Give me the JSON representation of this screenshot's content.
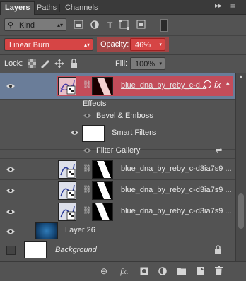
{
  "tabs": [
    {
      "label": "Layers"
    },
    {
      "label": "Paths"
    },
    {
      "label": "Channels"
    }
  ],
  "filter": {
    "kind_label": "Kind"
  },
  "blend": {
    "mode": "Linear Burn",
    "opacity_label": "Opacity:",
    "opacity_value": "46%"
  },
  "lock": {
    "label": "Lock:",
    "fill_label": "Fill:",
    "fill_value": "100%"
  },
  "layers": [
    {
      "name": "blue_dna_by_reby_c-d...",
      "selected": true
    },
    {
      "name": "blue_dna_by_reby_c-d3ia7s9 ..."
    },
    {
      "name": "blue_dna_by_reby_c-d3ia7s9 ..."
    },
    {
      "name": "blue_dna_by_reby_c-d3ia7s9 ..."
    },
    {
      "name": "Layer 26"
    },
    {
      "name": "Background"
    }
  ],
  "effects": {
    "label": "Effects",
    "bevel": "Bevel & Emboss",
    "smart_filters": "Smart Filters",
    "filter_gallery": "Filter Gallery"
  },
  "colors": {
    "highlight": "#d64545",
    "panel": "#535353",
    "selected_row": "#6a7d99"
  }
}
